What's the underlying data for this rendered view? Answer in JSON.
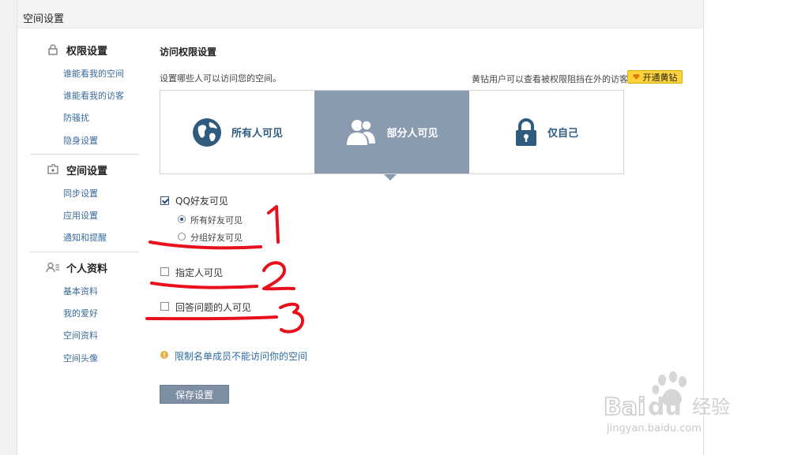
{
  "header": {
    "title": "空间设置"
  },
  "sidebar": {
    "sections": [
      {
        "title": "权限设置",
        "icon": "lock-icon",
        "items": [
          "谁能看我的空间",
          "谁能看我的访客",
          "防骚扰",
          "隐身设置"
        ]
      },
      {
        "title": "空间设置",
        "icon": "puzzle-icon",
        "items": [
          "同步设置",
          "应用设置",
          "通知和提醒"
        ]
      },
      {
        "title": "个人资料",
        "icon": "user-profile-icon",
        "items": [
          "基本资料",
          "我的爱好",
          "空间资料",
          "空间头像"
        ]
      }
    ]
  },
  "main": {
    "title": "访问权限设置",
    "desc": "设置哪些人可以访问您的空间。",
    "vip_note": "黄钻用户可以查看被权限阻挡在外的访客",
    "vip_button": "开通黄钻",
    "visibility": {
      "selected": "部分人可见",
      "options": [
        {
          "label": "所有人可见",
          "icon": "globe-icon"
        },
        {
          "label": "部分人可见",
          "icon": "users-icon"
        },
        {
          "label": "仅自己",
          "icon": "lock-icon"
        }
      ]
    },
    "qq_friends": {
      "label": "QQ好友可见",
      "checked": true,
      "sub_options": [
        {
          "label": "所有好友可见",
          "selected": true
        },
        {
          "label": "分组好友可见",
          "selected": false
        }
      ]
    },
    "designated": {
      "label": "指定人可见",
      "checked": false
    },
    "answer_question": {
      "label": "回答问题的人可见",
      "checked": false
    },
    "warning": "限制名单成员不能访问你的空间",
    "save_button": "保存设置"
  },
  "annotations": {
    "color": "#e8101a",
    "numbers": [
      "1",
      "2",
      "3"
    ]
  },
  "watermark": {
    "brand": "Baidu经验",
    "url": "jingyan.baidu.com"
  },
  "colors": {
    "accent_blue": "#2f5c7e",
    "selected_bg": "#8a9bb0",
    "link": "#3a6a9a",
    "vip": "#ffd33a"
  }
}
